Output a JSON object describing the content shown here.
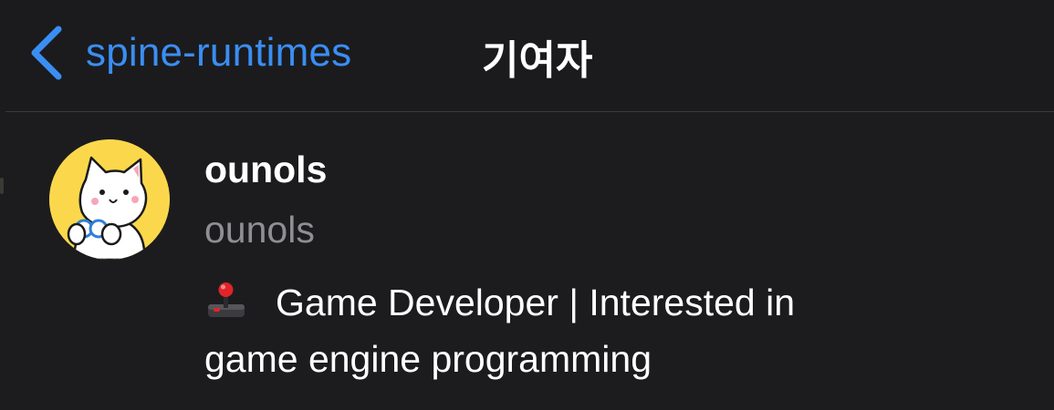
{
  "nav": {
    "back_label": "spine-runtimes",
    "title": "기여자",
    "back_icon": "chevron-left-icon"
  },
  "contributor": {
    "display_name": "ounols",
    "username": "ounols",
    "bio_emoji": "joystick-icon",
    "bio_line1": "Game Developer | Interested in",
    "bio_line2": "game engine programming",
    "avatar": "cat-avatar"
  },
  "colors": {
    "background": "#1c1c1e",
    "accent": "#3a8ef3",
    "secondary_text": "#8e8e93",
    "avatar_bg": "#fbd84b"
  }
}
